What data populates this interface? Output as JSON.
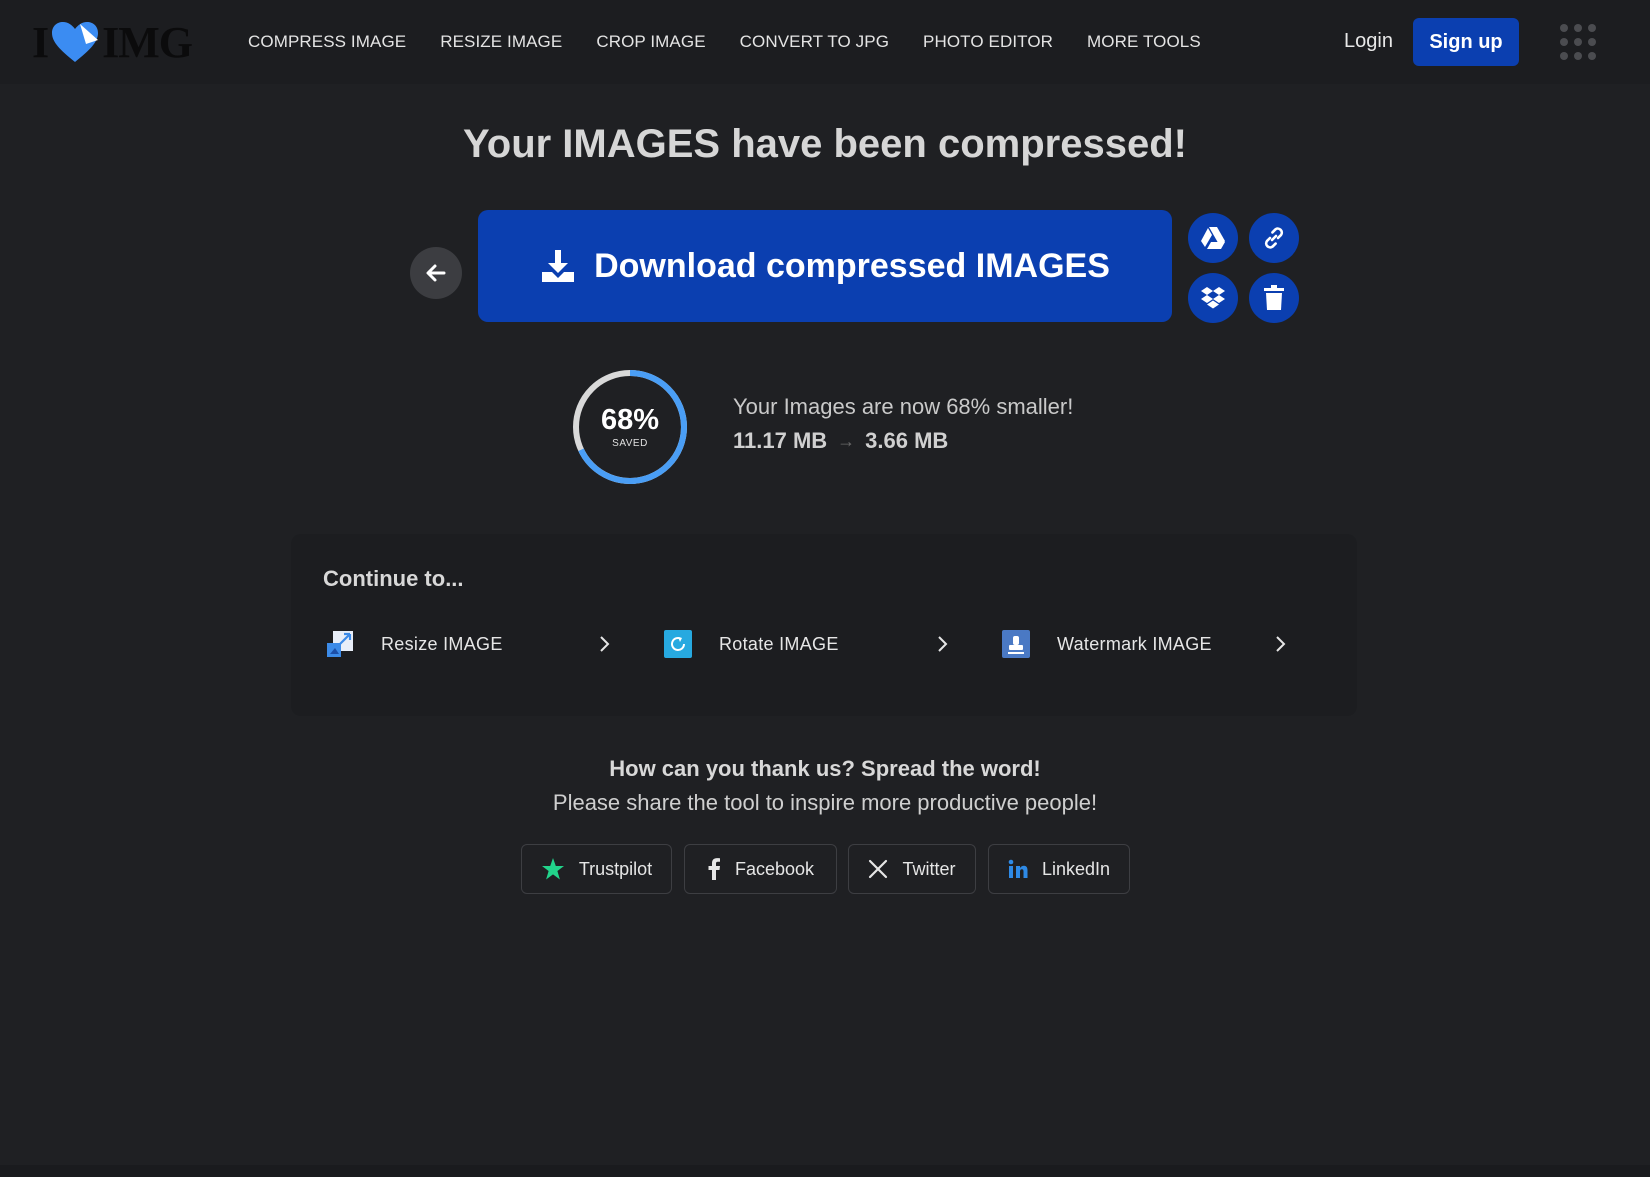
{
  "header": {
    "logo_left": "I",
    "logo_right": "IMG",
    "nav": [
      {
        "label": "COMPRESS IMAGE"
      },
      {
        "label": "RESIZE IMAGE"
      },
      {
        "label": "CROP IMAGE"
      },
      {
        "label": "CONVERT TO JPG"
      },
      {
        "label": "PHOTO EDITOR"
      },
      {
        "label": "MORE TOOLS"
      }
    ],
    "login": "Login",
    "signup": "Sign up"
  },
  "main": {
    "title": "Your IMAGES have been compressed!",
    "download_label": "Download compressed IMAGES",
    "stats": {
      "percent_saved": "68%",
      "percent_value": 68,
      "saved_label": "SAVED",
      "message": "Your Images are now 68% smaller!",
      "original_size": "11.17 MB",
      "arrow": "→",
      "new_size": "3.66 MB"
    }
  },
  "continue": {
    "title": "Continue to...",
    "items": [
      {
        "label": "Resize IMAGE",
        "icon": "resize-icon"
      },
      {
        "label": "Rotate IMAGE",
        "icon": "rotate-icon"
      },
      {
        "label": "Watermark IMAGE",
        "icon": "watermark-icon"
      }
    ]
  },
  "share": {
    "heading": "How can you thank us? Spread the word!",
    "subtext": "Please share the tool to inspire more productive people!",
    "buttons": [
      {
        "label": "Trustpilot",
        "icon": "star-icon"
      },
      {
        "label": "Facebook",
        "icon": "facebook-icon"
      },
      {
        "label": "Twitter",
        "icon": "x-icon"
      },
      {
        "label": "LinkedIn",
        "icon": "linkedin-icon"
      }
    ]
  },
  "colors": {
    "background": "#1f2023",
    "primary": "#0b3fb0",
    "ring_blue": "#4a9ef5",
    "ring_track": "#d9d9d9",
    "heart": "#3b8cf2"
  }
}
